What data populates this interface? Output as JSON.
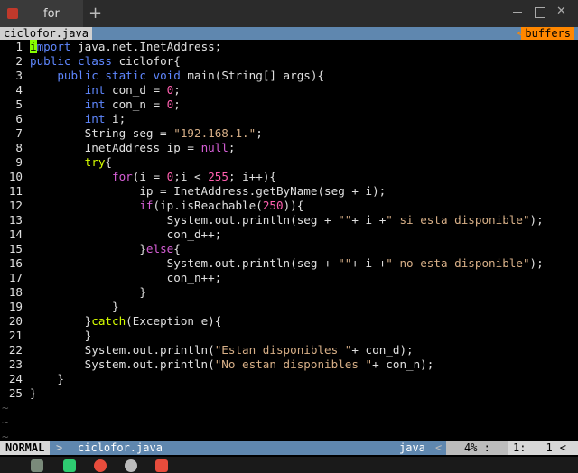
{
  "terminal": {
    "tab_title": "for",
    "new_tab": "+"
  },
  "vim": {
    "top_file": "ciclofor.java",
    "top_sep": "<",
    "top_buffers": "buffers",
    "lines": [
      {
        "n": "1",
        "segs": [
          [
            "i",
            "cursor"
          ],
          [
            "mport",
            "kw"
          ],
          [
            " java.net.InetAddress;",
            "tx"
          ]
        ]
      },
      {
        "n": "2",
        "segs": [
          [
            "public class",
            "kw"
          ],
          [
            " ciclofor{",
            "tx"
          ]
        ]
      },
      {
        "n": "3",
        "segs": [
          [
            "    ",
            "tx"
          ],
          [
            "public static void",
            "kw"
          ],
          [
            " main(String[] args){",
            "tx"
          ]
        ]
      },
      {
        "n": "4",
        "segs": [
          [
            "        ",
            "tx"
          ],
          [
            "int",
            "kw"
          ],
          [
            " con_d = ",
            "tx"
          ],
          [
            "0",
            "num"
          ],
          [
            ";",
            "tx"
          ]
        ]
      },
      {
        "n": "5",
        "segs": [
          [
            "        ",
            "tx"
          ],
          [
            "int",
            "kw"
          ],
          [
            " con_n = ",
            "tx"
          ],
          [
            "0",
            "num"
          ],
          [
            ";",
            "tx"
          ]
        ]
      },
      {
        "n": "6",
        "segs": [
          [
            "        ",
            "tx"
          ],
          [
            "int",
            "kw"
          ],
          [
            " i;",
            "tx"
          ]
        ]
      },
      {
        "n": "7",
        "segs": [
          [
            "        String seg = ",
            "tx"
          ],
          [
            "\"192.168.1.\"",
            "str"
          ],
          [
            ";",
            "tx"
          ]
        ]
      },
      {
        "n": "8",
        "segs": [
          [
            "        InetAddress ip = ",
            "tx"
          ],
          [
            "null",
            "kw2"
          ],
          [
            ";",
            "tx"
          ]
        ]
      },
      {
        "n": "9",
        "segs": [
          [
            "        ",
            "tx"
          ],
          [
            "try",
            "kw3"
          ],
          [
            "{",
            "tx"
          ]
        ]
      },
      {
        "n": "10",
        "segs": [
          [
            "            ",
            "tx"
          ],
          [
            "for",
            "kw2"
          ],
          [
            "(i = ",
            "tx"
          ],
          [
            "0",
            "num"
          ],
          [
            ";i < ",
            "tx"
          ],
          [
            "255",
            "num"
          ],
          [
            "; i++){",
            "tx"
          ]
        ]
      },
      {
        "n": "11",
        "segs": [
          [
            "                ip = InetAddress.getByName(seg + i);",
            "tx"
          ]
        ]
      },
      {
        "n": "12",
        "segs": [
          [
            "                ",
            "tx"
          ],
          [
            "if",
            "kw2"
          ],
          [
            "(ip.isReachable(",
            "tx"
          ],
          [
            "250",
            "num"
          ],
          [
            ")){",
            "tx"
          ]
        ]
      },
      {
        "n": "13",
        "segs": [
          [
            "                    System.out.println(seg + ",
            "tx"
          ],
          [
            "\"\"",
            "str"
          ],
          [
            "+ i +",
            "tx"
          ],
          [
            "\" si esta disponible\"",
            "str"
          ],
          [
            ");",
            "tx"
          ]
        ]
      },
      {
        "n": "14",
        "segs": [
          [
            "                    con_d++;",
            "tx"
          ]
        ]
      },
      {
        "n": "15",
        "segs": [
          [
            "                }",
            "tx"
          ],
          [
            "else",
            "kw2"
          ],
          [
            "{",
            "tx"
          ]
        ]
      },
      {
        "n": "16",
        "segs": [
          [
            "                    System.out.println(seg + ",
            "tx"
          ],
          [
            "\"\"",
            "str"
          ],
          [
            "+ i +",
            "tx"
          ],
          [
            "\" no esta disponible\"",
            "str"
          ],
          [
            ");",
            "tx"
          ]
        ]
      },
      {
        "n": "17",
        "segs": [
          [
            "                    con_n++;",
            "tx"
          ]
        ]
      },
      {
        "n": "18",
        "segs": [
          [
            "                }",
            "tx"
          ]
        ]
      },
      {
        "n": "19",
        "segs": [
          [
            "            }",
            "tx"
          ]
        ]
      },
      {
        "n": "20",
        "segs": [
          [
            "        }",
            "tx"
          ],
          [
            "catch",
            "kw3"
          ],
          [
            "(Exception e){",
            "tx"
          ]
        ]
      },
      {
        "n": "21",
        "segs": [
          [
            "        }",
            "tx"
          ]
        ]
      },
      {
        "n": "22",
        "segs": [
          [
            "        System.out.println(",
            "tx"
          ],
          [
            "\"Estan disponibles \"",
            "str"
          ],
          [
            "+ con_d);",
            "tx"
          ]
        ]
      },
      {
        "n": "23",
        "segs": [
          [
            "        System.out.println(",
            "tx"
          ],
          [
            "\"No estan disponibles \"",
            "str"
          ],
          [
            "+ con_n);",
            "tx"
          ]
        ]
      },
      {
        "n": "24",
        "segs": [
          [
            "    }",
            "tx"
          ]
        ]
      },
      {
        "n": "25",
        "segs": [
          [
            "}",
            "tx"
          ]
        ]
      }
    ],
    "tildes": [
      "~",
      "~",
      "~"
    ],
    "status": {
      "mode": "NORMAL",
      "sep": ">",
      "file": "ciclofor.java",
      "filetype": "java",
      "sep2": "<",
      "percent": "4% :",
      "line": "1:",
      "col": "1",
      "sep3": "<"
    }
  },
  "colors": {
    "kw": "#5f87ff",
    "kw2": "#d75fd7",
    "kw3": "#d7ff00",
    "str": "#d7af87",
    "num": "#ff5faf",
    "tx": "#e0e0e0"
  },
  "taskbar_icons": [
    "files-icon",
    "terminal-icon",
    "media-icon",
    "settings-icon",
    "browser-icon"
  ]
}
